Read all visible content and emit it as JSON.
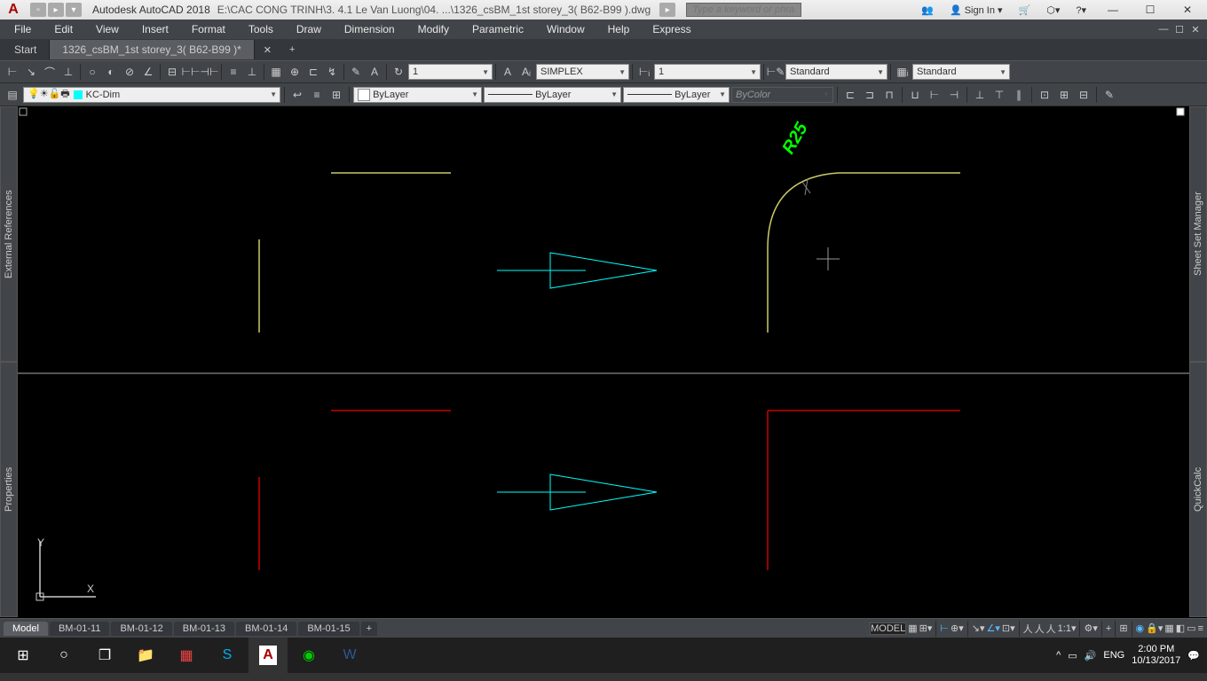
{
  "title": {
    "app": "Autodesk AutoCAD 2018",
    "path": "E:\\CAC CONG TRINH\\3. 4.1 Le Van Luong\\04. ...\\1326_csBM_1st storey_3( B62-B99 ).dwg",
    "search_placeholder": "Type a keyword or phrase",
    "sign_in": "Sign In"
  },
  "menu": [
    "File",
    "Edit",
    "View",
    "Insert",
    "Format",
    "Tools",
    "Draw",
    "Dimension",
    "Modify",
    "Parametric",
    "Window",
    "Help",
    "Express"
  ],
  "tabs": {
    "start": "Start",
    "file": "1326_csBM_1st storey_3( B62-B99 )*"
  },
  "dim_row": {
    "scale": "1",
    "textstyle": "SIMPLEX",
    "dimscale": "1",
    "dimstyle": "Standard",
    "tablestyle": "Standard"
  },
  "layer_row": {
    "layer": "KC-Dim",
    "color": "ByLayer",
    "linetype": "ByLayer",
    "lineweight": "ByLayer",
    "plotstyle": "ByColor"
  },
  "side_panels": {
    "left_top": "External References",
    "left_bottom": "Properties",
    "right_top": "Sheet Set Manager",
    "right_bottom": "QuickCalc"
  },
  "drawing": {
    "annotation": "R25",
    "ucs_y": "Y",
    "ucs_x": "X"
  },
  "layout_tabs": [
    "Model",
    "BM-01-11",
    "BM-01-12",
    "BM-01-13",
    "BM-01-14",
    "BM-01-15"
  ],
  "status": {
    "model": "MODEL",
    "scale": "1:1",
    "lang": "ENG",
    "time": "2:00 PM",
    "date": "10/13/2017"
  }
}
